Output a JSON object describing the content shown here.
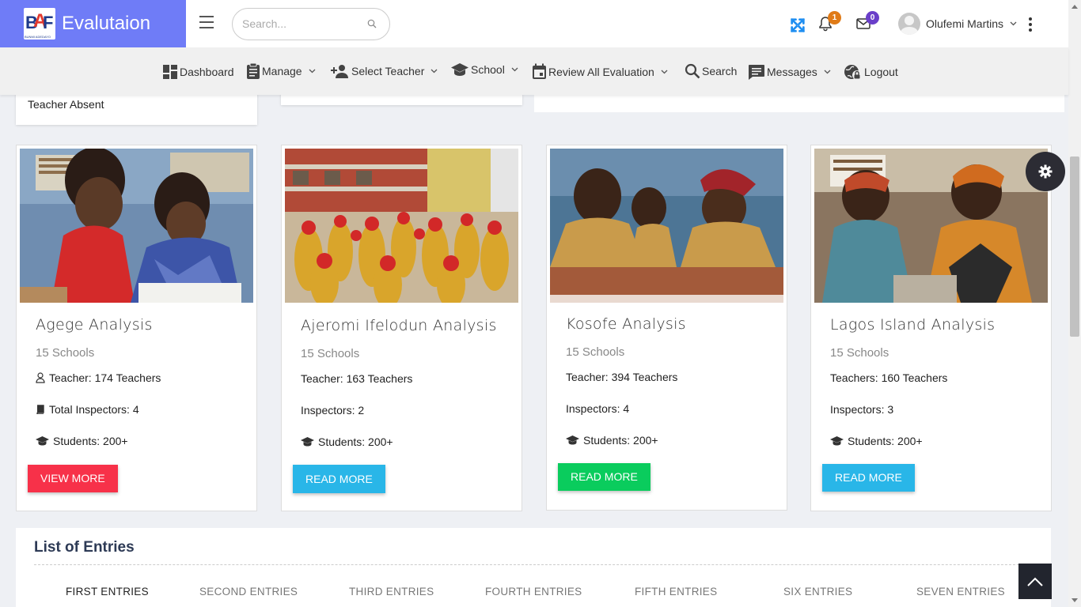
{
  "header": {
    "brand_title": "Evalutaion",
    "logo_letters": "BAF",
    "logo_subtext": "BUNMI ADEDAYO FOUNDATION",
    "search_placeholder": "Search...",
    "notifications_count": "1",
    "messages_count": "0",
    "user_name": "Olufemi Martins",
    "colors": {
      "brand_bg": "#6f7cf7",
      "notif_badge": "#e07b18",
      "msg_badge": "#6a3fc9",
      "fullscreen_icon": "#1f8ef1"
    }
  },
  "nav": {
    "items": [
      {
        "label": "Dashboard",
        "icon": "dashboard-icon"
      },
      {
        "label": "Manage",
        "icon": "clipboard-icon"
      },
      {
        "label": "Select Teacher",
        "icon": "person-add-icon"
      },
      {
        "label": "School",
        "icon": "graduation-cap-icon"
      },
      {
        "label": "Review All Evaluation",
        "icon": "calendar-icon"
      },
      {
        "label": "Search",
        "icon": "search-icon"
      },
      {
        "label": "Messages",
        "icon": "message-icon"
      },
      {
        "label": "Logout",
        "icon": "logout-globe-icon"
      }
    ]
  },
  "stats": {
    "teacher_absent_label": "Teacher Absent"
  },
  "cards": [
    {
      "title": "Agege Analysis",
      "schools": "15 Schools",
      "teachers": "Teacher: 174 Teachers",
      "inspectors": "Total Inspectors: 4",
      "students": "Students: 200+",
      "button": "VIEW MORE",
      "button_color": "#f73149"
    },
    {
      "title": "Ajeromi Ifelodun Analysis",
      "schools": "15 Schools",
      "teachers": "Teacher: 163 Teachers",
      "inspectors": "Inspectors: 2",
      "students": "Students: 200+",
      "button": "READ MORE",
      "button_color": "#29b6e8"
    },
    {
      "title": "Kosofe Analysis",
      "schools": "15 Schools",
      "teachers": "Teacher: 394 Teachers",
      "inspectors": "Inspectors: 4",
      "students": "Students: 200+",
      "button": "READ MORE",
      "button_color": "#0acc5d"
    },
    {
      "title": "Lagos Island Analysis",
      "schools": "15 Schools",
      "teachers": "Teachers: 160 Teachers",
      "inspectors": "Inspectors: 3",
      "students": "Students: 200+",
      "button": "READ MORE",
      "button_color": "#29b6e8"
    }
  ],
  "entries": {
    "title": "List of Entries",
    "tabs": [
      "FIRST ENTRIES",
      "SECOND ENTRIES",
      "THIRD ENTRIES",
      "FOURTH ENTRIES",
      "FIFTH ENTRIES",
      "SIX ENTRIES",
      "SEVEN ENTRIES"
    ]
  }
}
